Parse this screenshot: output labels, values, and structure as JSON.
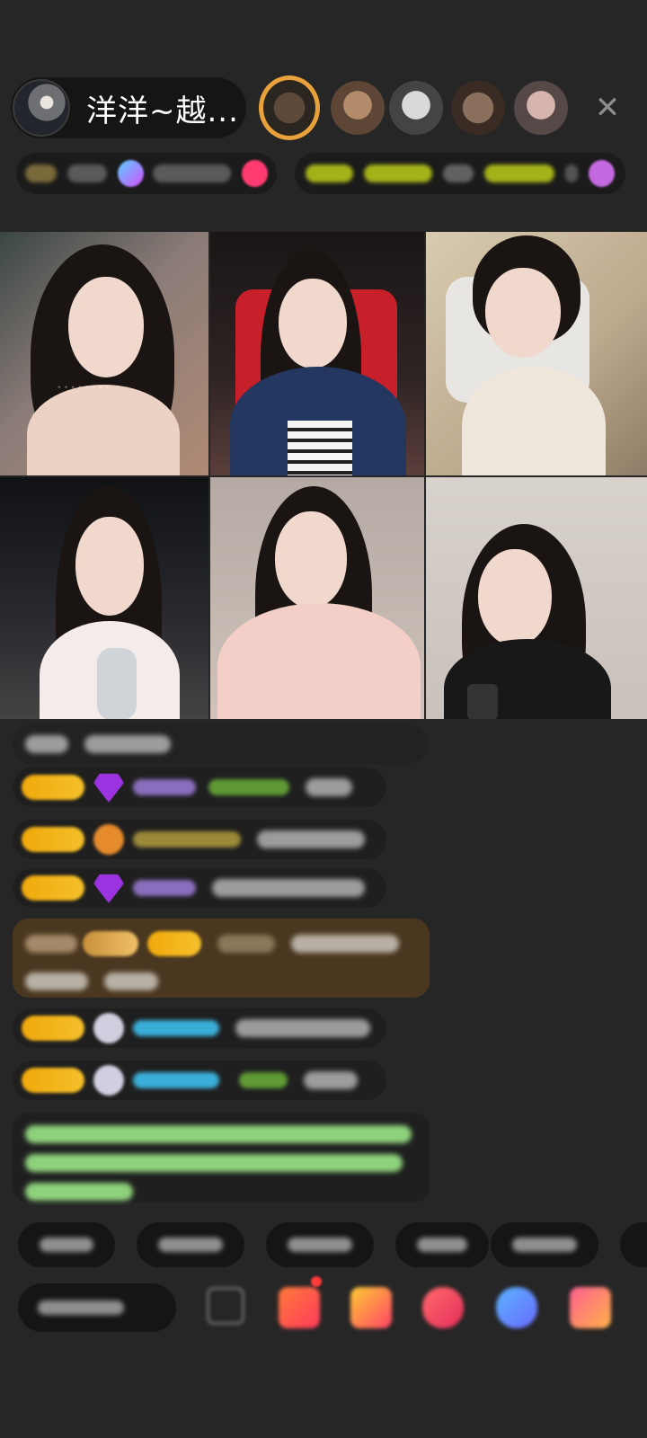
{
  "header": {
    "host_name": "洋洋~越...",
    "close_icon": "close-icon",
    "viewer_avatars": 5
  },
  "colors": {
    "background": "#262626",
    "badge_gold": "#f0a90c",
    "top_viewer_ring": "#e9a23b",
    "chat_name_green": "#5f9a34",
    "chat_name_cyan": "#3aaed8",
    "system_msg_green": "#8fd27c",
    "chair_red": "#c8202a"
  },
  "video_grid": {
    "rows": 2,
    "columns": 3,
    "tiles": 6
  },
  "icons": [
    "close-icon",
    "grid-icon",
    "gift-box-icon",
    "shop-bag-icon",
    "red-packet-icon",
    "chat-bubble-icon",
    "more-icon"
  ]
}
